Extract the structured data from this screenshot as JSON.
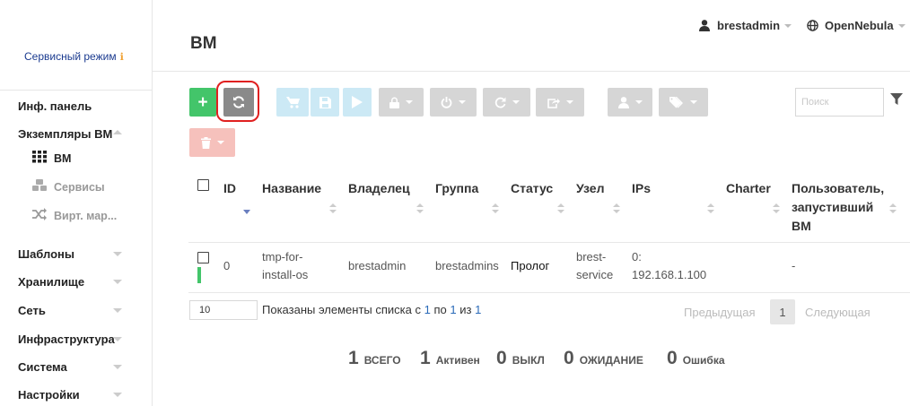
{
  "sidebar": {
    "service_mode": "Сервисный режим",
    "service_mode_icon": "info-icon",
    "items": {
      "dashboard": "Инф. панель",
      "vm_instances": "Экземпляры ВМ",
      "vms": "ВМ",
      "services": "Сервисы",
      "virtual_routers": "Вирт. мар...",
      "templates": "Шаблоны",
      "storage": "Хранилище",
      "network": "Сеть",
      "infrastructure": "Инфраструктура",
      "system": "Система",
      "settings": "Настройки"
    }
  },
  "header": {
    "title": "ВМ",
    "user": "brestadmin",
    "zone": "OpenNebula"
  },
  "toolbar": {
    "search_placeholder": "Поиск",
    "icons": [
      "plus-icon",
      "refresh-icon",
      "cart-icon",
      "save-icon",
      "play-icon",
      "lock-icon",
      "power-icon",
      "reboot-icon",
      "export-icon",
      "user-icon",
      "tags-icon",
      "trash-icon",
      "filter-icon"
    ]
  },
  "table": {
    "headers": {
      "id": "ID",
      "name": "Название",
      "owner": "Владелец",
      "group": "Группа",
      "status": "Статус",
      "host": "Узел",
      "ips": "IPs",
      "charter": "Charter",
      "started_by": [
        "Пользователь,",
        "запустивший",
        "ВМ"
      ]
    },
    "rows": [
      {
        "id": "0",
        "name": [
          "tmp-for-",
          "install-os"
        ],
        "owner": "brestadmin",
        "group": "brestadmins",
        "status": "Пролог",
        "host": [
          "brest-",
          "service"
        ],
        "ips": [
          "0:",
          "192.168.1.100"
        ],
        "charter": "",
        "started_by": "-"
      }
    ]
  },
  "pagination": {
    "page_size": "10",
    "showing_prefix": "Показаны элементы списка с",
    "from": "1",
    "to_word": "по",
    "to": "1",
    "of_word": "из",
    "total": "1",
    "previous": "Предыдущая",
    "current_page": "1",
    "next": "Следующая"
  },
  "summary": {
    "total": {
      "value": "1",
      "label": "ВСЕГО"
    },
    "active": {
      "value": "1",
      "label": "Активен"
    },
    "off": {
      "value": "0",
      "label": "ВЫКЛ"
    },
    "pending": {
      "value": "0",
      "label": "ОЖИДАНИЕ"
    },
    "error": {
      "value": "0",
      "label": "Ошибка"
    }
  },
  "colors": {
    "green": "#43c56a",
    "highlight": "#e02020",
    "link_blue": "#2a6ab8"
  }
}
